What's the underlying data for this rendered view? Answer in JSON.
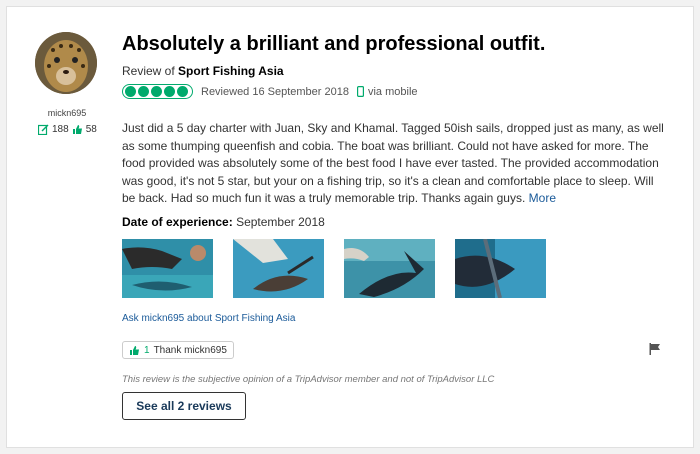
{
  "reviewer": {
    "username": "mickn695",
    "review_count": "188",
    "helpful_votes": "58"
  },
  "review": {
    "title": "Absolutely a brilliant and professional outfit.",
    "review_of_prefix": "Review of",
    "business_name": "Sport Fishing Asia",
    "rating_bubbles": 5,
    "reviewed_date": "Reviewed 16 September 2018",
    "via": "via mobile",
    "body": "Just did a 5 day charter with Juan, Sky and Khamal. Tagged 50ish sails, dropped just as many, as well as some thumping queenfish and cobia. The boat was brilliant. Could not have asked for more. The food provided was absolutely some of the best food I have ever tasted. The provided accommodation was good, it's not 5 star, but your on a fishing trip, so it's a clean and comfortable place to sleep. Will be back. Had so much fun it was a truly memorable trip. Thanks again guys.",
    "more_label": "More",
    "date_of_experience_label": "Date of experience:",
    "date_of_experience": "September 2018"
  },
  "ask_link": "Ask mickn695 about Sport Fishing Asia",
  "thank": {
    "count": "1",
    "label": "Thank mickn695"
  },
  "disclaimer": "This review is the subjective opinion of a TripAdvisor member and not of TripAdvisor LLC",
  "see_all_label": "See all 2 reviews",
  "colors": {
    "accent_green": "#00aa6c",
    "link_blue": "#1a5a99"
  }
}
